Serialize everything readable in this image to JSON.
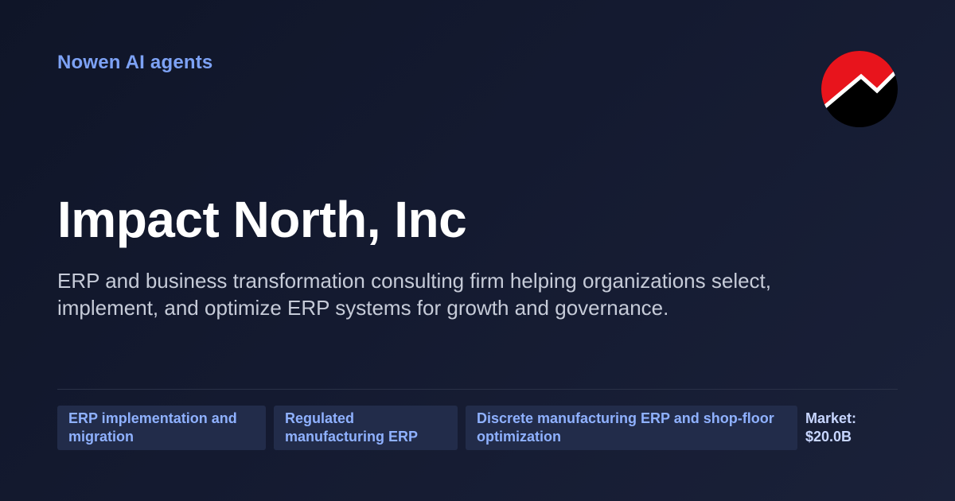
{
  "brand": {
    "label": "Nowen AI agents"
  },
  "logo": {
    "icon": "rising-trend-logo-icon",
    "colors": {
      "top": "#e8141c",
      "bottom": "#000000",
      "line": "#ffffff"
    }
  },
  "company": {
    "name": "Impact North, Inc",
    "description": "ERP and business transformation consulting firm helping organizations select, implement, and optimize ERP systems for growth and governance."
  },
  "tags": [
    {
      "label": "ERP implementation and migration"
    },
    {
      "label": "Regulated manufacturing ERP"
    },
    {
      "label": "Discrete manufacturing ERP and shop-floor optimization"
    }
  ],
  "market": {
    "label": "Market:",
    "value": "$20.0B"
  },
  "colors": {
    "background": "#141a30",
    "accent": "#7da2f5",
    "tag_background": "#222c4a",
    "tag_text": "#8fb1ff"
  }
}
